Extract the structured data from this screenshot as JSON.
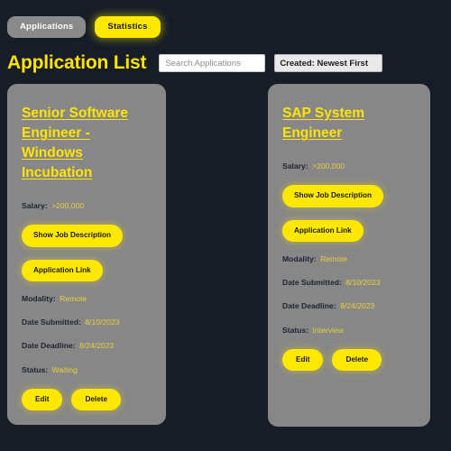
{
  "tabs": [
    {
      "label": "Applications",
      "active": false
    },
    {
      "label": "Statistics",
      "active": true
    }
  ],
  "header": {
    "title": "Application List",
    "search_value": "",
    "search_placeholder": "Search Applications",
    "sort_selected": "Created: Newest First"
  },
  "labels": {
    "salary": "Salary:",
    "modality": "Modality:",
    "date_submitted": "Date Submitted:",
    "date_deadline": "Date Deadline:",
    "status": "Status:",
    "show_description": "Show Job Description",
    "application_link": "Application Link",
    "edit": "Edit",
    "delete": "Delete"
  },
  "colors": {
    "page_background": "#161d27",
    "card_background": "#878787",
    "accent_yellow": "#ffe800",
    "title_yellow": "#ffe400",
    "value_yellow": "#e8d13c",
    "label_dark": "#1c2430",
    "tab_inactive": "#8a8a8a"
  },
  "cards": [
    {
      "title": "Senior Software Engineer - Windows Incubation",
      "salary": ">200,000",
      "modality": "Remote",
      "date_submitted": "8/10/2023",
      "date_deadline": "8/24/2023",
      "status": "Waiting"
    },
    {
      "title": "SAP System Engineer",
      "salary": ">200,000",
      "modality": "Remote",
      "date_submitted": "8/10/2023",
      "date_deadline": "8/24/2023",
      "status": "Interview"
    }
  ]
}
